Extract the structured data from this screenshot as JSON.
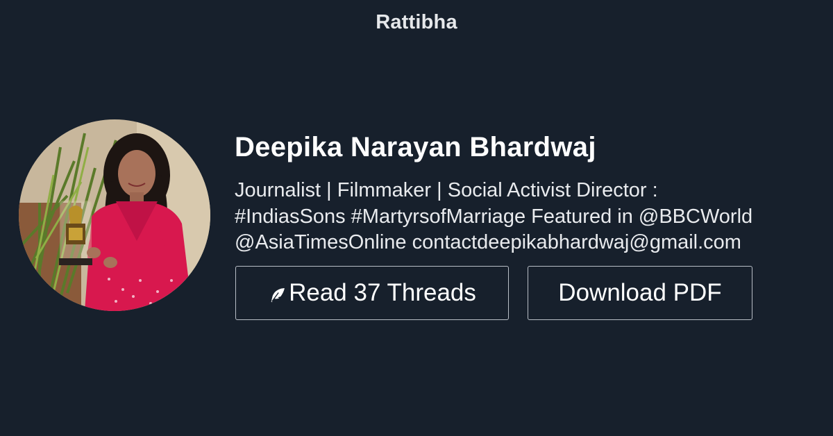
{
  "header": {
    "site_name": "Rattibha"
  },
  "profile": {
    "name": "Deepika Narayan Bhardwaj",
    "bio_lines": [
      "Journalist | Filmmaker | Social Activist Director :",
      "#IndiasSons #MartyrsofMarriage Featured in @BBCWorld",
      "@AsiaTimesOnline contactdeepikabhardwaj@gmail.com"
    ],
    "avatar_icon": "profile-photo"
  },
  "actions": {
    "read_threads_label": "Read 37 Threads",
    "read_threads_icon": "feather-icon",
    "download_pdf_label": "Download PDF"
  },
  "colors": {
    "background": "#17202c",
    "text": "#ffffff",
    "button_border": "#b9bfc7"
  }
}
